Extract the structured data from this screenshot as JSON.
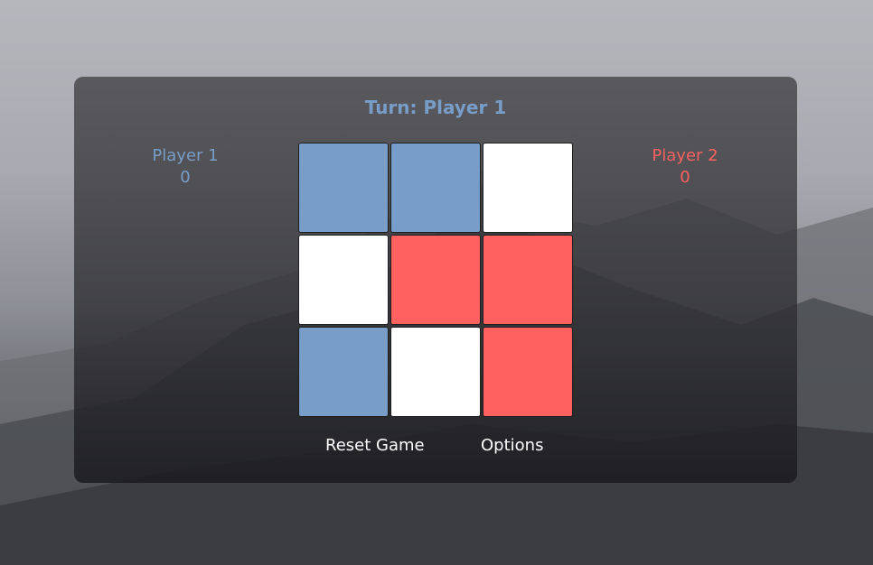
{
  "turn_text": "Turn: Player 1",
  "players": [
    {
      "name": "Player 1",
      "score": "0"
    },
    {
      "name": "Player 2",
      "score": "0"
    }
  ],
  "colors": {
    "player1": "#789dc9",
    "player2": "#ff6161",
    "empty": "#ffffff"
  },
  "board": [
    "player1",
    "player1",
    "empty",
    "empty",
    "player2",
    "player2",
    "player1",
    "empty",
    "player2"
  ],
  "buttons": {
    "reset": "Reset Game",
    "options": "Options"
  }
}
